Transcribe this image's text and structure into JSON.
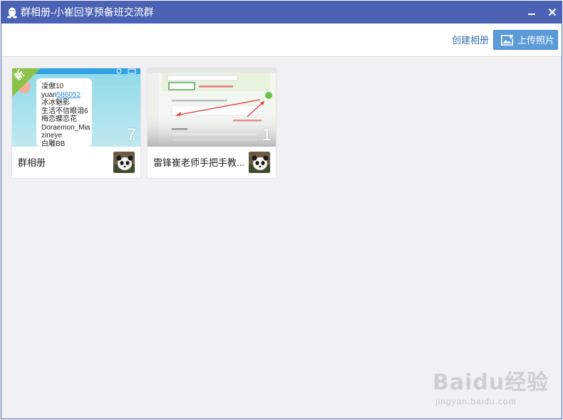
{
  "window": {
    "title": "群相册-小崔回享预备班交流群"
  },
  "toolbar": {
    "create_album_label": "创建相册",
    "upload_label": "上传照片"
  },
  "albums": [
    {
      "name": "群相册",
      "count": "7",
      "badge": "新",
      "cover_lines": [
        "凌傲10",
        "yuan",
        "586052",
        "冰冰魅影",
        "生活不信眼泪6",
        "梅恋蝶恋花",
        "Doraemon_Mia",
        "zineye",
        "白雕BB"
      ]
    },
    {
      "name": "雷锋崔老师手把手教...",
      "count": "1"
    }
  ],
  "watermark": {
    "text": "Baidu经验",
    "sub": "jingyan.baidu.com"
  },
  "colors": {
    "titlebar": "#4b62b5",
    "upload_button": "#5b9bd8",
    "link": "#3a6fb5",
    "new_badge": "#8bc34a"
  }
}
